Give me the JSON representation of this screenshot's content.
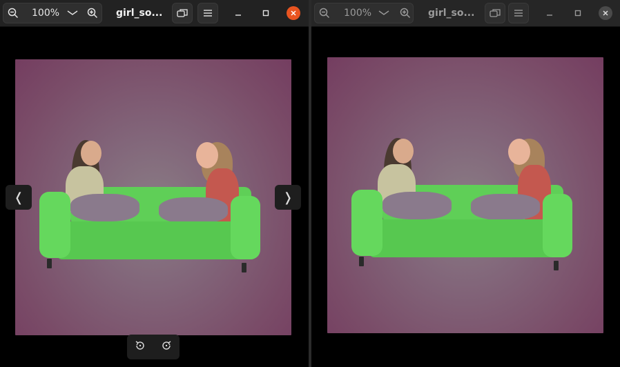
{
  "left_window": {
    "zoom": "100%",
    "title": "girl_so...",
    "prev_glyph": "❬",
    "next_glyph": "❭",
    "active": true
  },
  "right_window": {
    "zoom": "100%",
    "title": "girl_so...",
    "active": false
  },
  "icons": {
    "zoom_out": "zoom-out-icon",
    "zoom_in": "zoom-in-icon",
    "dropdown": "chevron-down-icon",
    "restore": "window-restore-icon",
    "menu": "hamburger-menu-icon",
    "minimize": "minimize-icon",
    "maximize": "maximize-icon",
    "close": "close-icon",
    "rotate_left": "rotate-left-icon",
    "rotate_right": "rotate-right-icon"
  },
  "colors": {
    "close_active": "#e95420",
    "sofa_green": "#5fcf57",
    "background_magenta": "#7a4c68"
  }
}
